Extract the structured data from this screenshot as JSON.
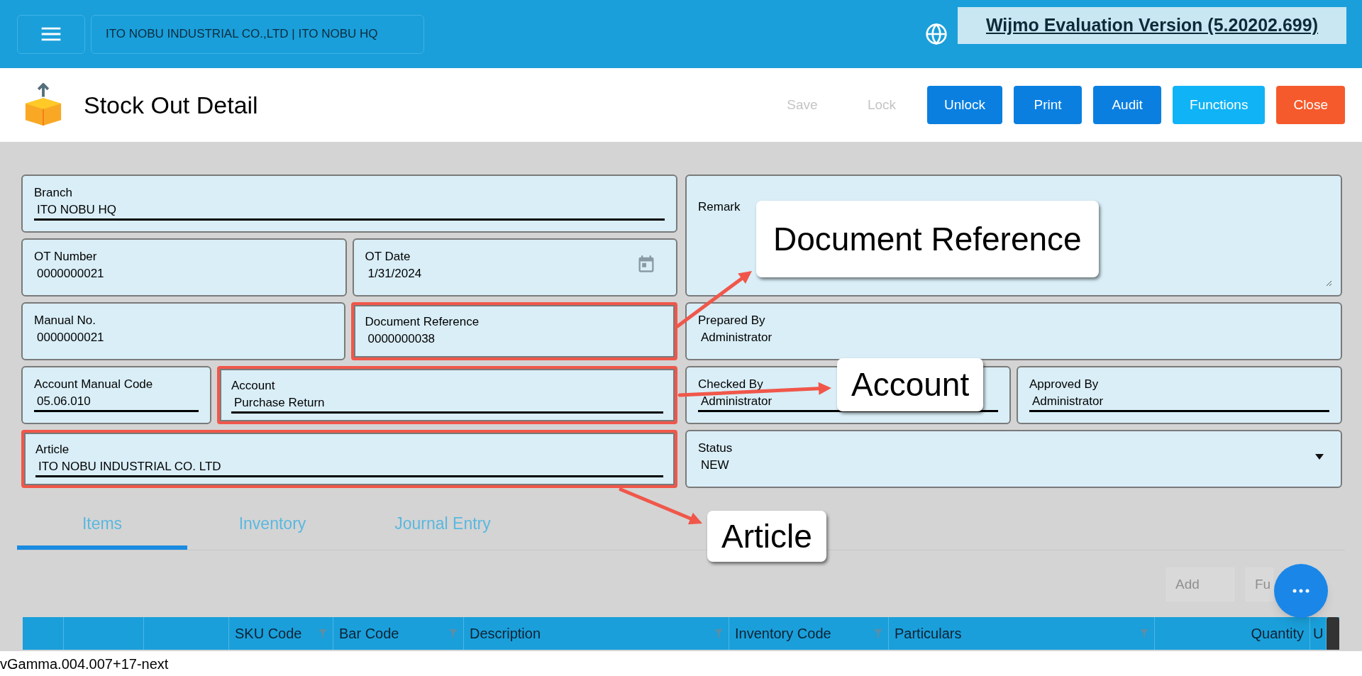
{
  "header": {
    "company": "ITO NOBU INDUSTRIAL CO.,LTD | ITO NOBU HQ",
    "banner": "Wijmo Evaluation Version (5.20202.699)"
  },
  "page": {
    "title": "Stock Out Detail",
    "actions": [
      {
        "label": "Save",
        "kind": "plain",
        "disabled": true
      },
      {
        "label": "Lock",
        "kind": "plain",
        "disabled": true
      },
      {
        "label": "Unlock",
        "kind": "primary",
        "disabled": false
      },
      {
        "label": "Print",
        "kind": "primary",
        "disabled": false
      },
      {
        "label": "Audit",
        "kind": "primary",
        "disabled": false
      },
      {
        "label": "Functions",
        "kind": "accent",
        "disabled": false
      },
      {
        "label": "Close",
        "kind": "danger",
        "disabled": false
      }
    ]
  },
  "form": {
    "left_rows": [
      [
        {
          "label": "Branch",
          "value": "ITO NOBU HQ",
          "kind": "text",
          "underlined": true,
          "highlighted": false
        }
      ],
      [
        {
          "label": "OT Number",
          "value": "0000000021",
          "kind": "text",
          "underlined": false,
          "highlighted": false
        },
        {
          "label": "OT Date",
          "value": "1/31/2024",
          "kind": "date",
          "underlined": false,
          "highlighted": false
        }
      ],
      [
        {
          "label": "Manual No.",
          "value": "0000000021",
          "kind": "text",
          "underlined": false,
          "highlighted": false
        },
        {
          "label": "Document Reference",
          "value": "0000000038",
          "kind": "text",
          "underlined": false,
          "highlighted": true
        }
      ],
      [
        {
          "label": "Account Manual Code",
          "value": "05.06.010",
          "kind": "text",
          "underlined": true,
          "highlighted": false
        },
        {
          "label": "Account",
          "value": "Purchase Return",
          "kind": "text",
          "underlined": true,
          "highlighted": true
        }
      ],
      [
        {
          "label": "Article",
          "value": "ITO NOBU INDUSTRIAL CO. LTD",
          "kind": "text",
          "underlined": true,
          "highlighted": true
        }
      ]
    ],
    "right_rows": [
      [
        {
          "label": "Remark",
          "kind": "textarea",
          "highlighted": false
        }
      ],
      [
        {
          "label": "Prepared By",
          "value": "Administrator",
          "kind": "text",
          "underlined": false,
          "highlighted": false
        }
      ],
      [
        {
          "label": "Checked By",
          "value": "Administrator",
          "kind": "text",
          "underlined": true,
          "highlighted": false
        },
        {
          "label": "Approved By",
          "value": "Administrator",
          "kind": "text",
          "underlined": true,
          "highlighted": false
        }
      ],
      [
        {
          "label": "Status",
          "value": "NEW",
          "kind": "select",
          "underlined": false,
          "highlighted": false
        }
      ]
    ]
  },
  "tabs": [
    {
      "label": "Items",
      "selected": true
    },
    {
      "label": "Inventory",
      "selected": false
    },
    {
      "label": "Journal Entry",
      "selected": false
    }
  ],
  "grid_buttons": [
    {
      "label": "Add",
      "disabled": true
    },
    {
      "label": "Fu",
      "disabled": true
    }
  ],
  "table": {
    "columns": [
      {
        "filter": false
      },
      {
        "filter": false
      },
      {
        "filter": false
      },
      {
        "label": "SKU Code",
        "filter": true
      },
      {
        "label": "Bar Code",
        "filter": true
      },
      {
        "label": "Description",
        "filter": true
      },
      {
        "label": "Inventory Code",
        "filter": true
      },
      {
        "label": "Particulars",
        "filter": true
      },
      {
        "label": "Quantity",
        "filter": false
      },
      {
        "label": "U",
        "filter": false
      }
    ]
  },
  "callouts": [
    {
      "text": "Document Reference"
    },
    {
      "text": "Account"
    },
    {
      "text": "Article"
    }
  ],
  "footer": {
    "version": "vGamma.004.007+17-next"
  }
}
